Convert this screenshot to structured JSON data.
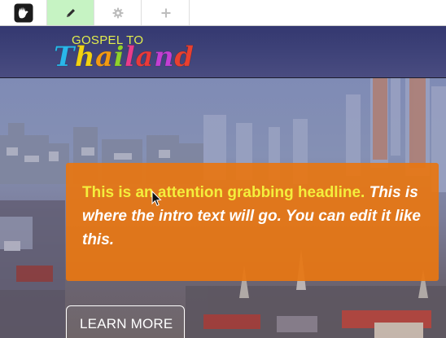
{
  "toolbar": {
    "buttons": [
      {
        "name": "concrete5-logo",
        "icon": "concrete5-hand-icon"
      },
      {
        "name": "edit",
        "icon": "pencil-icon",
        "active": true
      },
      {
        "name": "settings",
        "icon": "gear-icon"
      },
      {
        "name": "add",
        "icon": "plus-icon"
      }
    ],
    "active_color": "#c6f3c3"
  },
  "header": {
    "brand_top": "GOSPEL TO",
    "brand_letters": [
      {
        "char": "T",
        "color": "#2ab7ea"
      },
      {
        "char": "h",
        "color": "#f2d312"
      },
      {
        "char": "a",
        "color": "#f29a13"
      },
      {
        "char": "i",
        "color": "#8fd12c"
      },
      {
        "char": "l",
        "color": "#e93c8c"
      },
      {
        "char": "a",
        "color": "#e83a3a"
      },
      {
        "char": "n",
        "color": "#c23fd4"
      },
      {
        "char": "d",
        "color": "#e84030"
      }
    ]
  },
  "hero": {
    "headline": "This is an attention grabbing headline.",
    "intro": " This is where the intro text will go.  You can edit it like this.",
    "button_label": "LEARN MORE",
    "callout_color": "#e77612",
    "headline_color": "#f4ee3c"
  }
}
